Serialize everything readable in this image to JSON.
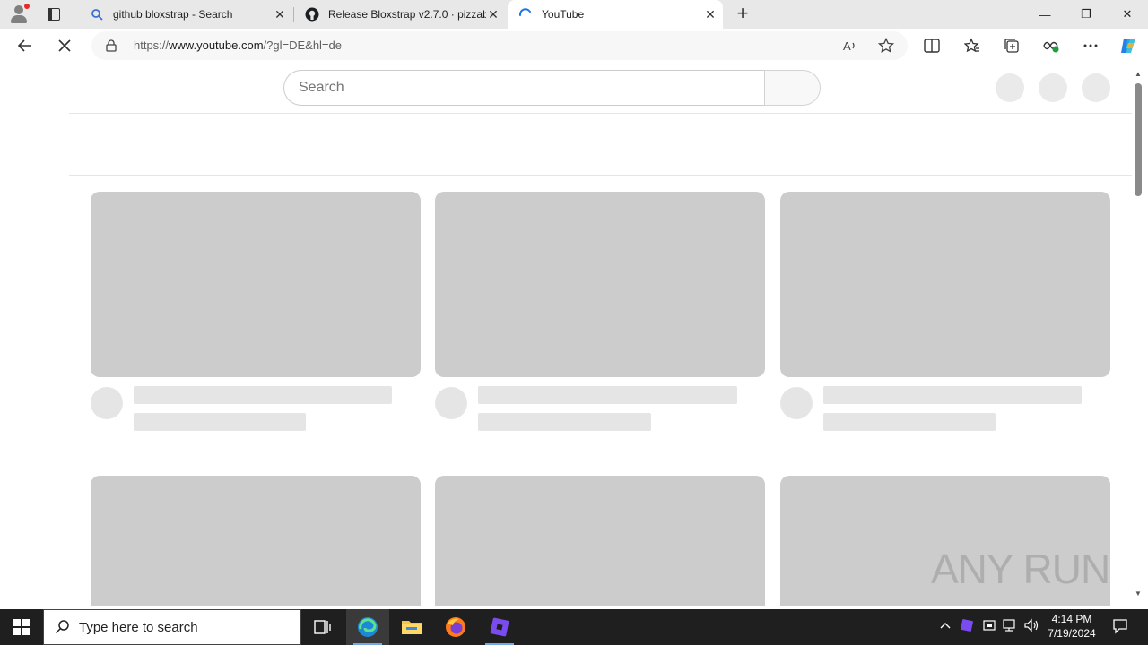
{
  "browser": {
    "tabs": [
      {
        "title": "github bloxstrap - Search",
        "close": "✕"
      },
      {
        "title": "Release Bloxstrap v2.7.0 · pizzabo",
        "close": "✕"
      },
      {
        "title": "YouTube",
        "close": "✕"
      }
    ],
    "new_tab": "+",
    "window": {
      "minimize": "—",
      "maximize": "❐",
      "close": "✕"
    },
    "address": {
      "prefix": "https://",
      "host": "www.youtube.com",
      "path": "/?gl=DE&hl=de"
    }
  },
  "page": {
    "search_placeholder": "Search",
    "watermark": "ANY RUN"
  },
  "taskbar": {
    "search_placeholder": "Type here to search",
    "time": "4:14 PM",
    "date": "7/19/2024"
  }
}
